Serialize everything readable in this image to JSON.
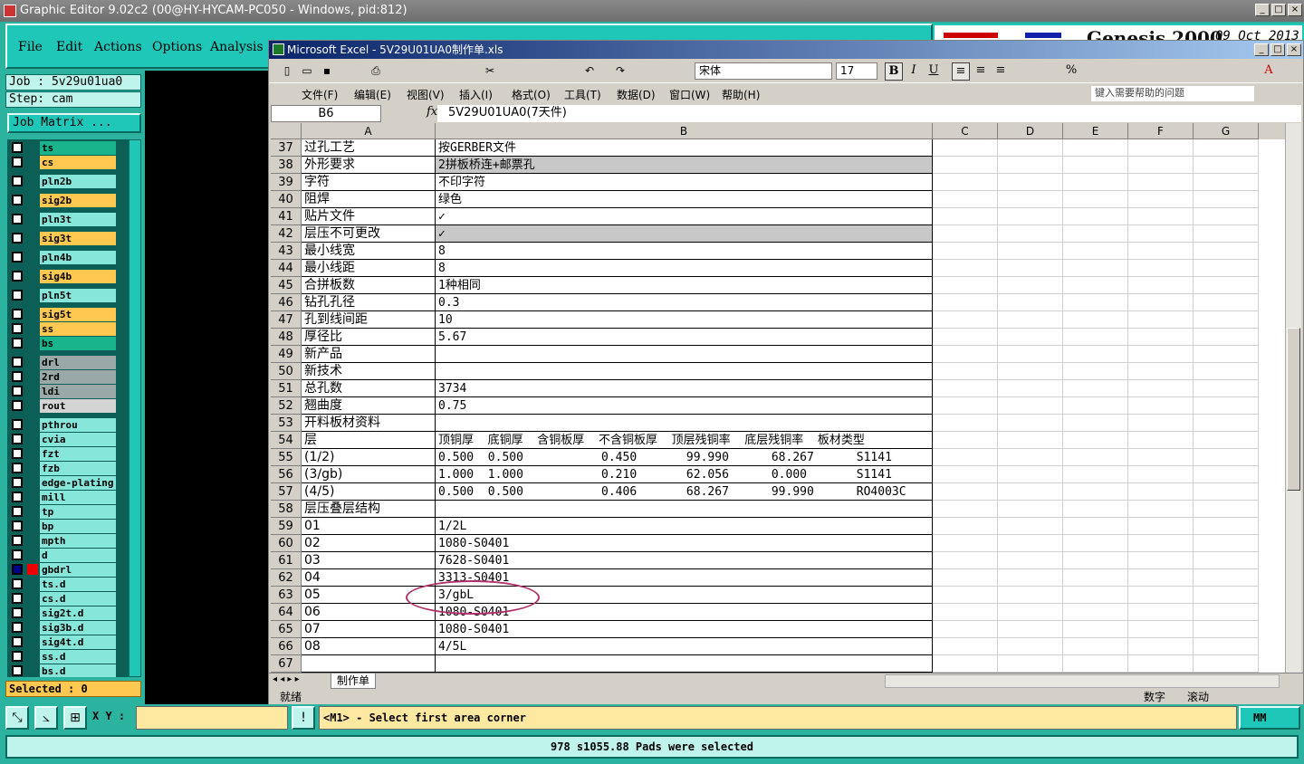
{
  "app_title": "Graphic Editor 9.02c2 (00@HY-HYCAM-PC050 - Windows, pid:812)",
  "main_menu": [
    "File",
    "Edit",
    "Actions",
    "Options",
    "Analysis"
  ],
  "genesis": {
    "title": "Genesis 2000",
    "date": "09 Oct 2013"
  },
  "job": {
    "job_label": "Job : 5v29u01ua0",
    "step_label": "Step: cam",
    "matrix_button": "Job Matrix ..."
  },
  "layers": [
    {
      "name": "ts",
      "color": "#1ab48c"
    },
    {
      "name": "cs",
      "color": "#ffc850"
    },
    {
      "name": "pln2b",
      "color": "#86e6da"
    },
    {
      "name": "sig2b",
      "color": "#ffc850"
    },
    {
      "name": "pln3t",
      "color": "#86e6da"
    },
    {
      "name": "sig3t",
      "color": "#ffc850"
    },
    {
      "name": "pln4b",
      "color": "#86e6da"
    },
    {
      "name": "sig4b",
      "color": "#ffc850"
    },
    {
      "name": "pln5t",
      "color": "#86e6da"
    },
    {
      "name": "sig5t",
      "color": "#ffc850"
    },
    {
      "name": "ss",
      "color": "#ffc850"
    },
    {
      "name": "bs",
      "color": "#1ab48c"
    },
    {
      "name": "drl",
      "color": "#9aa8a8"
    },
    {
      "name": "2rd",
      "color": "#9aa8a8"
    },
    {
      "name": "ldi",
      "color": "#9aa8a8"
    },
    {
      "name": "rout",
      "color": "#d4d4d4"
    },
    {
      "name": "pthrou",
      "color": "#86e6da"
    },
    {
      "name": "cvia",
      "color": "#86e6da"
    },
    {
      "name": "fzt",
      "color": "#86e6da"
    },
    {
      "name": "fzb",
      "color": "#86e6da"
    },
    {
      "name": "edge-plating",
      "color": "#86e6da"
    },
    {
      "name": "mill",
      "color": "#86e6da"
    },
    {
      "name": "tp",
      "color": "#86e6da"
    },
    {
      "name": "bp",
      "color": "#86e6da"
    },
    {
      "name": "mpth",
      "color": "#86e6da"
    },
    {
      "name": "d",
      "color": "#86e6da"
    },
    {
      "name": "gbdrl",
      "color": "#86e6da"
    },
    {
      "name": "ts.d",
      "color": "#86e6da"
    },
    {
      "name": "cs.d",
      "color": "#86e6da"
    },
    {
      "name": "sig2t.d",
      "color": "#86e6da"
    },
    {
      "name": "sig3b.d",
      "color": "#86e6da"
    },
    {
      "name": "sig4t.d",
      "color": "#86e6da"
    },
    {
      "name": "ss.d",
      "color": "#86e6da"
    },
    {
      "name": "bs.d",
      "color": "#86e6da"
    }
  ],
  "selected_label": "Selected : 0",
  "excel": {
    "title": "Microsoft Excel - 5V29U01UA0制作单.xls",
    "font_name": "宋体",
    "font_size": "17",
    "menu": [
      "文件(F)",
      "编辑(E)",
      "视图(V)",
      "插入(I)",
      "格式(O)",
      "工具(T)",
      "数据(D)",
      "窗口(W)",
      "帮助(H)"
    ],
    "help_placeholder": "键入需要帮助的问题",
    "name_box": "B6",
    "fx": "fx",
    "formula": "5V29U01UA0(7天件)",
    "columns": [
      "A",
      "B",
      "C",
      "D",
      "E",
      "F",
      "G"
    ],
    "rows": [
      {
        "n": "37",
        "a": "过孔工艺",
        "b": "按GERBER文件",
        "hl": false
      },
      {
        "n": "38",
        "a": "外形要求",
        "b": "2拼板桥连+邮票孔",
        "hl": true
      },
      {
        "n": "39",
        "a": "字符",
        "b": "不印字符",
        "hl": false
      },
      {
        "n": "40",
        "a": "阻焊",
        "b": "绿色",
        "hl": false
      },
      {
        "n": "41",
        "a": "贴片文件",
        "b": "✓",
        "hl": false
      },
      {
        "n": "42",
        "a": "层压不可更改",
        "b": "✓",
        "hl": true
      },
      {
        "n": "43",
        "a": "最小线宽",
        "b": "8",
        "hl": false
      },
      {
        "n": "44",
        "a": "最小线距",
        "b": "8",
        "hl": false
      },
      {
        "n": "45",
        "a": "合拼板数",
        "b": "1种相同",
        "hl": false
      },
      {
        "n": "46",
        "a": "钻孔孔径",
        "b": "0.3",
        "hl": false
      },
      {
        "n": "47",
        "a": "孔到线间距",
        "b": "10",
        "hl": false
      },
      {
        "n": "48",
        "a": "厚径比",
        "b": "5.67",
        "hl": false
      },
      {
        "n": "49",
        "a": "新产品",
        "b": "",
        "hl": false
      },
      {
        "n": "50",
        "a": "新技术",
        "b": "",
        "hl": false
      },
      {
        "n": "51",
        "a": "总孔数",
        "b": "3734",
        "hl": false
      },
      {
        "n": "52",
        "a": "翘曲度",
        "b": "0.75",
        "hl": false
      },
      {
        "n": "53",
        "a": "开料板材资料",
        "b": "",
        "hl": false
      },
      {
        "n": "54",
        "a": "层",
        "b": "顶铜厚  底铜厚  含铜板厚  不含铜板厚  顶层残铜率  底层残铜率  板材类型",
        "hl": false
      },
      {
        "n": "55",
        "a": "(1/2)",
        "b": "0.500  0.500           0.450       99.990      68.267      S1141",
        "hl": false
      },
      {
        "n": "56",
        "a": "(3/gb)",
        "b": "1.000  1.000           0.210       62.056      0.000       S1141",
        "hl": false
      },
      {
        "n": "57",
        "a": "(4/5)",
        "b": "0.500  0.500           0.406       68.267      99.990      RO4003C",
        "hl": false
      },
      {
        "n": "58",
        "a": "层压叠层结构",
        "b": "",
        "hl": false
      },
      {
        "n": "59",
        "a": "01",
        "b": "1/2L",
        "hl": false
      },
      {
        "n": "60",
        "a": "02",
        "b": "1080-S0401",
        "hl": false
      },
      {
        "n": "61",
        "a": "03",
        "b": "7628-S0401",
        "hl": false
      },
      {
        "n": "62",
        "a": "04",
        "b": "3313-S0401",
        "hl": false
      },
      {
        "n": "63",
        "a": "05",
        "b": "3/gbL",
        "hl": false
      },
      {
        "n": "64",
        "a": "06",
        "b": "1080-S0401",
        "hl": false
      },
      {
        "n": "65",
        "a": "07",
        "b": "1080-S0401",
        "hl": false
      },
      {
        "n": "66",
        "a": "08",
        "b": "4/5L",
        "hl": false
      },
      {
        "n": "67",
        "a": "",
        "b": "",
        "hl": false
      }
    ],
    "sheet_tab": "制作单",
    "status_ready": "就绪",
    "status_num": "数字",
    "status_scroll": "滚动"
  },
  "bottom": {
    "xy_label": "X Y :",
    "message": "<M1> - Select first area corner",
    "units": "MM",
    "info": "978 s1055.88 Pads were selected"
  }
}
